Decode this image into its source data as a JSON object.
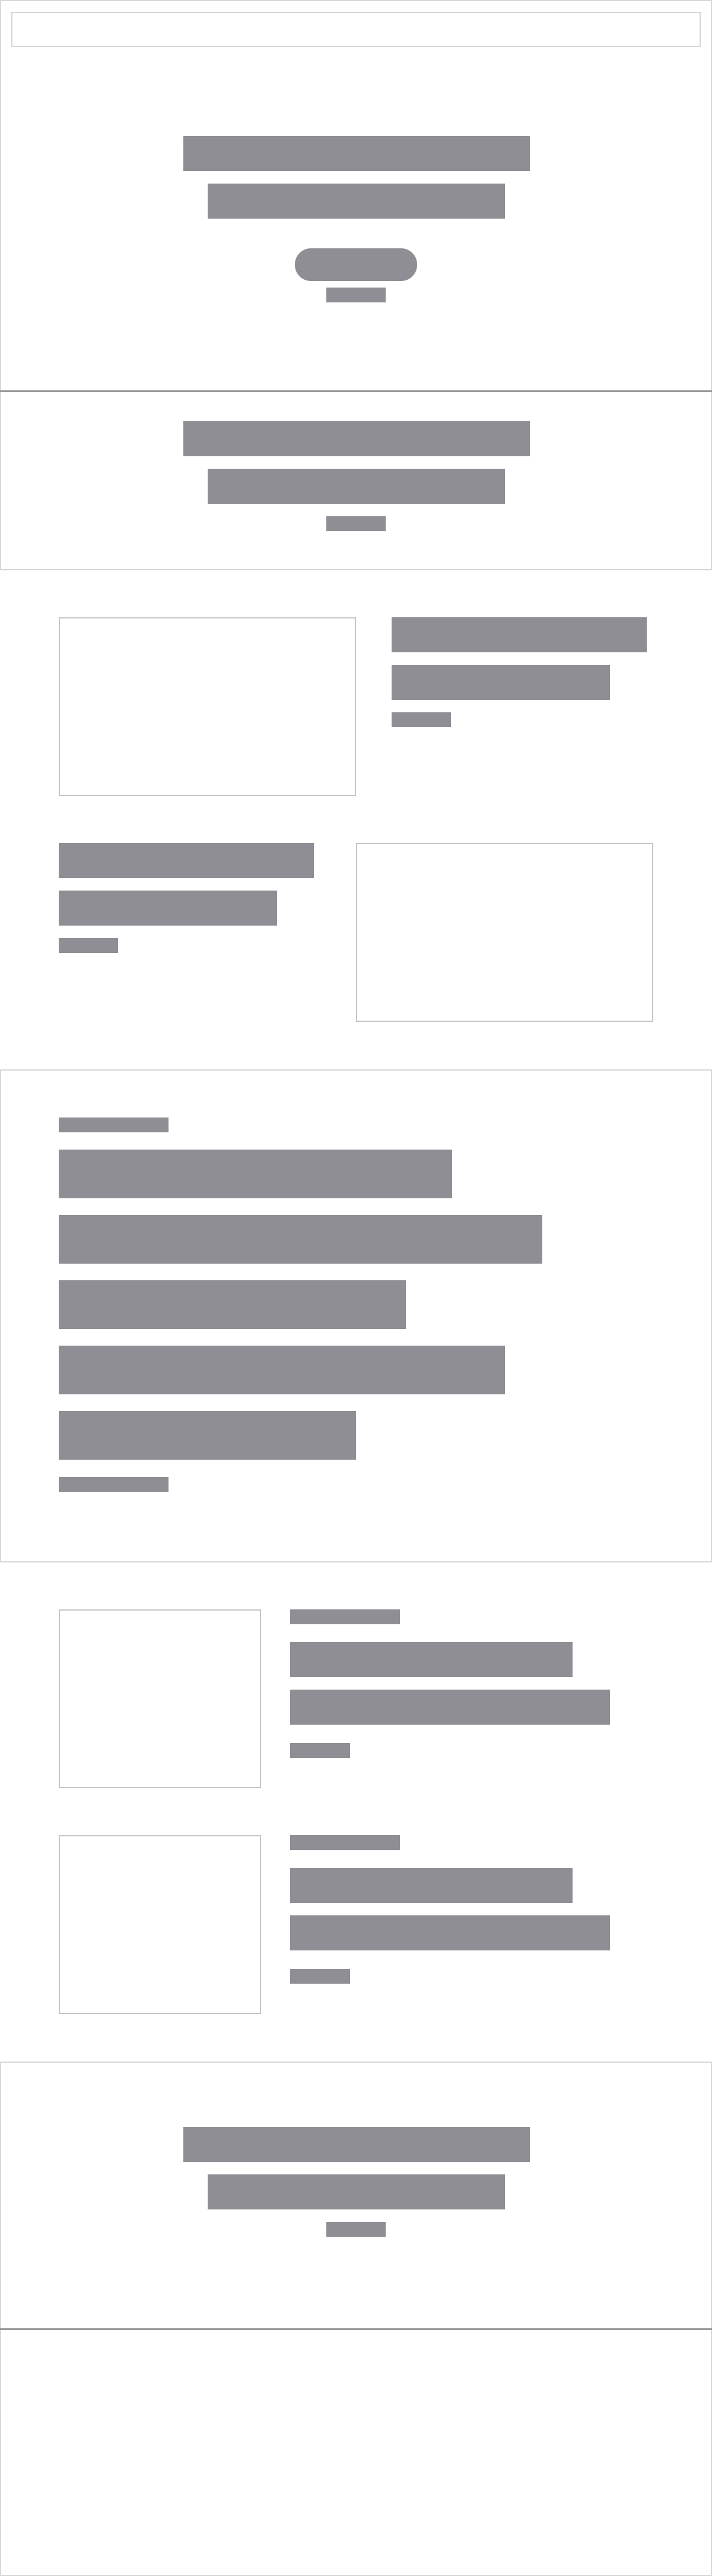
{
  "theme": {
    "placeholder_color": "#8f8e94",
    "frame_border_color": "#d6d6d9",
    "divider_color": "#999999",
    "background": "#ffffff"
  },
  "note_on_content": "",
  "header": {
    "search_placeholder": ""
  },
  "hero": {
    "title_line_1": "",
    "title_line_2": "",
    "cta_label": "",
    "caption": ""
  },
  "intro": {
    "title_line_1": "",
    "title_line_2": "",
    "caption": ""
  },
  "features": [
    {
      "title_line_1": "",
      "title_line_2": "",
      "caption": ""
    },
    {
      "title_line_1": "",
      "title_line_2": "",
      "caption": ""
    }
  ],
  "highlight": {
    "kicker": "",
    "lines": [
      "",
      "",
      "",
      "",
      ""
    ],
    "footer": ""
  },
  "articles": [
    {
      "kicker": "",
      "title_line_1": "",
      "title_line_2": "",
      "meta": ""
    },
    {
      "kicker": "",
      "title_line_1": "",
      "title_line_2": "",
      "meta": ""
    }
  ],
  "closing": {
    "title_line_1": "",
    "title_line_2": "",
    "caption": ""
  },
  "footer": {}
}
